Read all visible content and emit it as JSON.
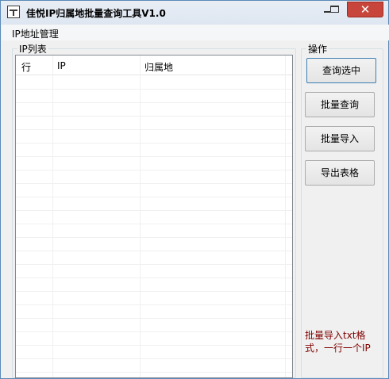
{
  "window": {
    "title": "佳悦IP归属地批量查询工具V1.0",
    "minimize_symbol": "",
    "close_symbol": "✕"
  },
  "menu": {
    "items": [
      {
        "label": "IP地址管理"
      }
    ]
  },
  "ip_group": {
    "legend": "IP列表",
    "columns": [
      {
        "label": "行"
      },
      {
        "label": "IP"
      },
      {
        "label": "归属地"
      }
    ],
    "rows": []
  },
  "ops_group": {
    "legend": "操作",
    "buttons": [
      {
        "label": "查询选中"
      },
      {
        "label": "批量查询"
      },
      {
        "label": "批量导入"
      },
      {
        "label": "导出表格"
      }
    ]
  },
  "hint": {
    "lines": [
      "批量导入txt格",
      "式，一行一个IP"
    ],
    "color": "#800000"
  },
  "colors": {
    "close_button": "#c7453b",
    "window_bg": "#f0f0f0",
    "list_bg": "#ffffff"
  }
}
